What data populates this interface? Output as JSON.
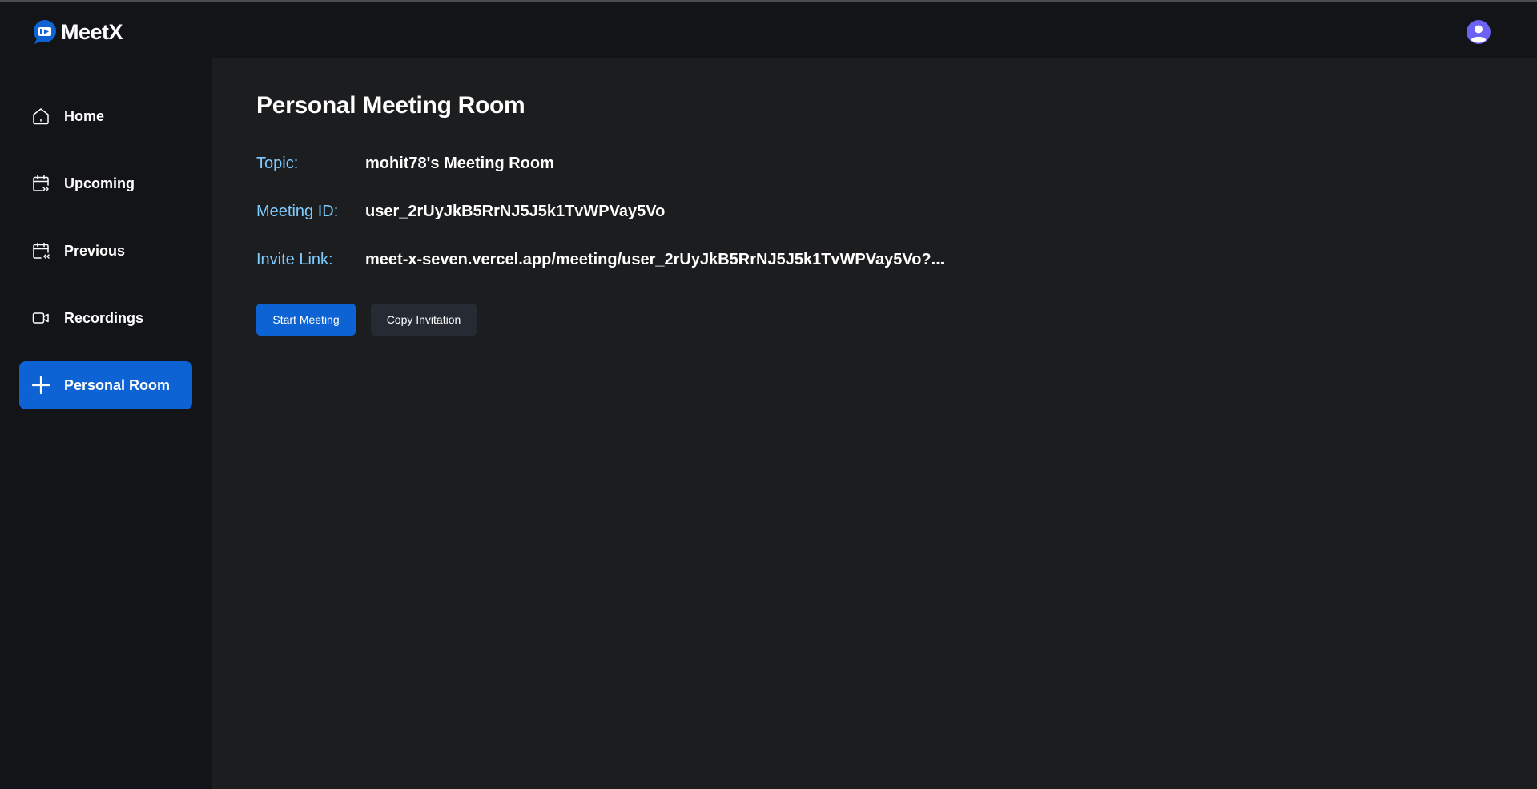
{
  "brand": {
    "name": "MeetX"
  },
  "sidebar": {
    "items": [
      {
        "label": "Home",
        "icon": "home-icon",
        "active": false
      },
      {
        "label": "Upcoming",
        "icon": "calendar-upcoming-icon",
        "active": false
      },
      {
        "label": "Previous",
        "icon": "calendar-previous-icon",
        "active": false
      },
      {
        "label": "Recordings",
        "icon": "video-camera-icon",
        "active": false
      },
      {
        "label": "Personal Room",
        "icon": "plus-icon",
        "active": true
      }
    ]
  },
  "main": {
    "title": "Personal Meeting Room",
    "rows": [
      {
        "label": "Topic:",
        "value": "mohit78's Meeting Room"
      },
      {
        "label": "Meeting ID:",
        "value": "user_2rUyJkB5RrNJ5J5k1TvWPVay5Vo"
      },
      {
        "label": "Invite Link:",
        "value": "meet-x-seven.vercel.app/meeting/user_2rUyJkB5RrNJ5J5k1TvWPVay5Vo?..."
      }
    ],
    "buttons": {
      "start": "Start Meeting",
      "copy": "Copy Invitation"
    }
  },
  "colors": {
    "accent": "#0e63d4",
    "label_blue": "#7ecbff",
    "sidebar_bg": "#131417",
    "main_bg": "#1c1d1f",
    "avatar": "#6c63f5"
  }
}
